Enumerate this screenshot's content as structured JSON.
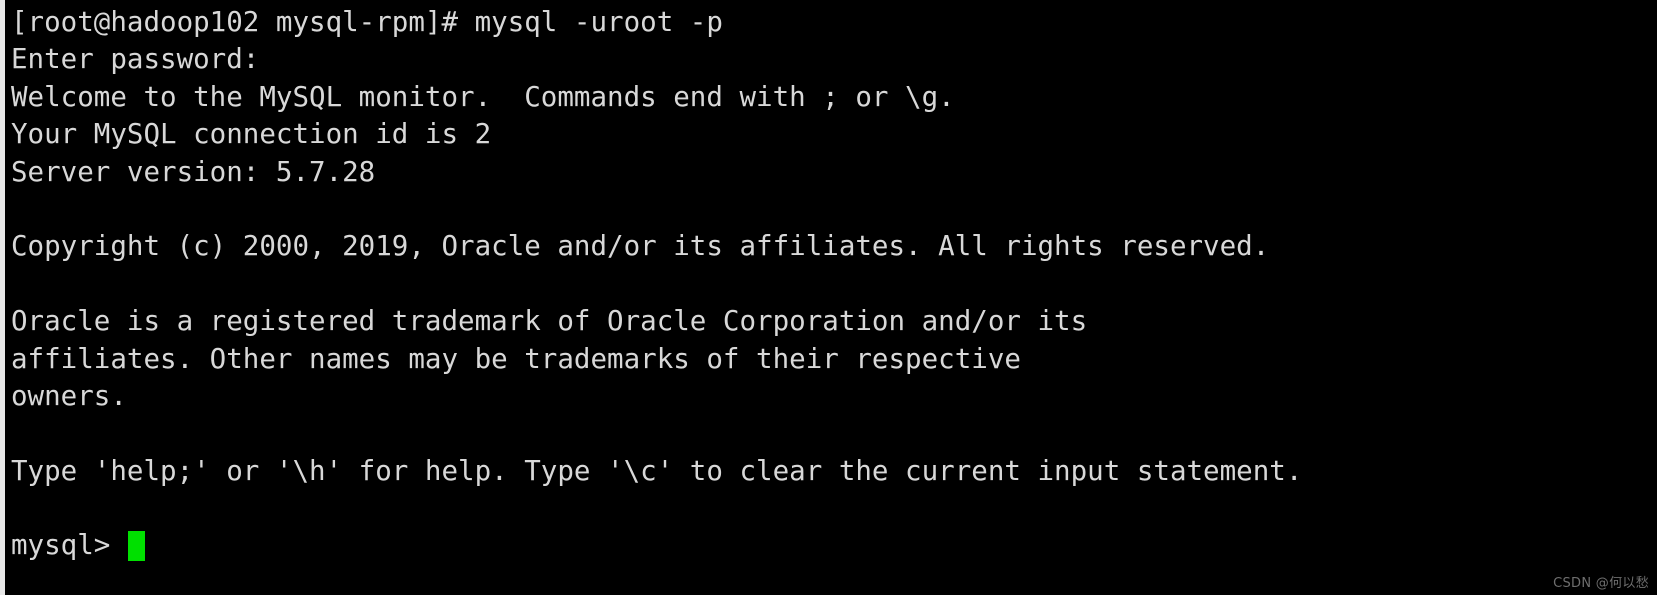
{
  "terminal": {
    "background_color": "#000000",
    "foreground_color": "#d8d8d8",
    "cursor_color": "#00e000",
    "lines": [
      "[root@hadoop102 mysql-rpm]# mysql -uroot -p",
      "Enter password:",
      "Welcome to the MySQL monitor.  Commands end with ; or \\g.",
      "Your MySQL connection id is 2",
      "Server version: 5.7.28",
      "",
      "Copyright (c) 2000, 2019, Oracle and/or its affiliates. All rights reserved.",
      "",
      "Oracle is a registered trademark of Oracle Corporation and/or its",
      "affiliates. Other names may be trademarks of their respective",
      "owners.",
      "",
      "Type 'help;' or '\\h' for help. Type '\\c' to clear the current input statement.",
      ""
    ],
    "prompt": "mysql> ",
    "command_input": ""
  },
  "watermark": {
    "text": "CSDN @何以愁"
  }
}
